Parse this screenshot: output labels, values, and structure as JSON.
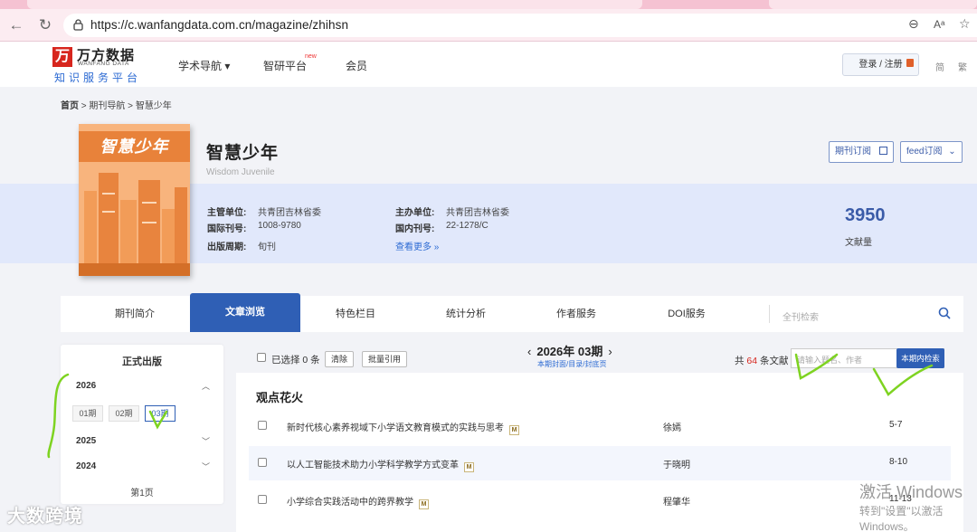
{
  "browser": {
    "url": "https://c.wanfangdata.com.cn/magazine/zhihsn",
    "back_icon": "arrow-left-icon",
    "refresh_icon": "refresh-icon"
  },
  "header": {
    "logo_mark": "万",
    "logo_name": "万方数据",
    "logo_en": "WANFANG DATA",
    "logo_sub": "知识服务平台",
    "nav": [
      {
        "label": "学术导航 ▾"
      },
      {
        "label": "智研平台"
      },
      {
        "label": "会员"
      }
    ],
    "new_badge": "new",
    "login_label": "登录 / 注册",
    "lang_simplified": "简",
    "lang_traditional": "繁"
  },
  "breadcrumb": {
    "home": "首页",
    "sep1": " > ",
    "middle": "期刊导航",
    "sep2": " > ",
    "current": "智慧少年"
  },
  "magazine": {
    "cover_title": "智慧少年",
    "title": "智慧少年",
    "title_en": "Wisdom Juvenile",
    "subscribe_label": "期刊订阅",
    "feed_label": "feed订阅",
    "meta": [
      {
        "label": "主管单位:",
        "value": "共青团吉林省委"
      },
      {
        "label": "国际刊号:",
        "value": "1008-9780"
      },
      {
        "label": "出版周期:",
        "value": "旬刊"
      },
      {
        "label": "主办单位:",
        "value": "共青团吉林省委"
      },
      {
        "label": "国内刊号:",
        "value": "22-1278/C"
      }
    ],
    "more_link": "查看更多 »",
    "doc_count": "3950",
    "doc_count_label": "文献量"
  },
  "tabs": [
    {
      "label": "期刊简介"
    },
    {
      "label": "文章浏览"
    },
    {
      "label": "特色栏目"
    },
    {
      "label": "统计分析"
    },
    {
      "label": "作者服务"
    },
    {
      "label": "DOI服务"
    }
  ],
  "tab_search_placeholder": "全刊检索",
  "left_panel": {
    "title": "正式出版",
    "years": [
      "2026",
      "2025",
      "2024"
    ],
    "issues": [
      "01期",
      "02期",
      "03期"
    ],
    "page_label": "第1页"
  },
  "toolbar": {
    "selected_text": "已选择 0 条",
    "clear_label": "清除",
    "batch_cite_label": "批量引用",
    "issue_title": "2026年 03期",
    "issue_prev": "‹",
    "issue_next": "›",
    "issue_links": "本期封面/目录/封底页",
    "total_prefix": "共 ",
    "total_count": "64",
    "total_suffix": " 条文献",
    "search_placeholder": "请输入题名、作者",
    "search_button": "本期内检索"
  },
  "section": {
    "title": "观点花火",
    "articles": [
      {
        "title": "新时代核心素养视域下小学语文教育模式的实践与思考",
        "badge": "M",
        "author": "徐嫣",
        "pages": "5-7"
      },
      {
        "title": "以人工智能技术助力小学科学教学方式变革",
        "badge": "M",
        "author": "于晓明",
        "pages": "8-10"
      },
      {
        "title": "小学综合实践活动中的跨界教学",
        "badge": "M",
        "author": "程肇华",
        "pages": "11-13"
      }
    ]
  },
  "overlay": {
    "watermark": "大数跨境",
    "win_activate": "激活 Windows",
    "win_activate_sub": "转到\"设置\"以激活 Windows。"
  }
}
